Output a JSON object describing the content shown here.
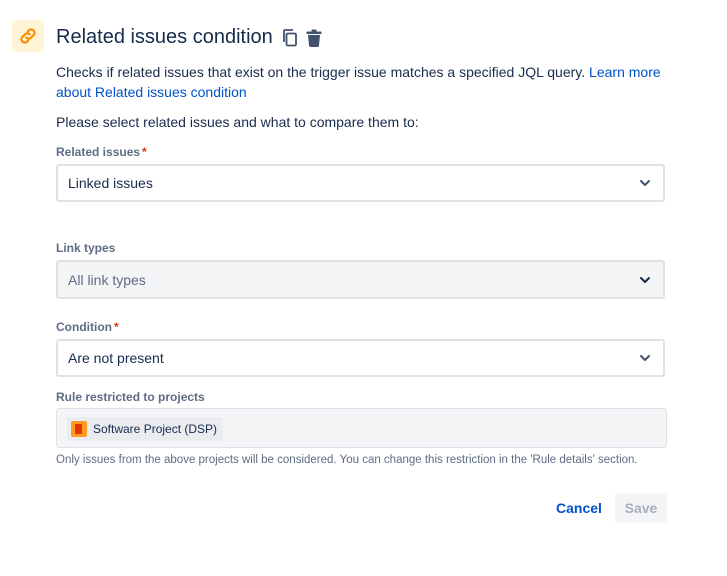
{
  "condition": {
    "title": "Related issues condition",
    "icon": "link-icon",
    "actions": [
      "copy-icon",
      "trash-icon"
    ]
  },
  "description": {
    "text": "Checks if related issues that exist on the trigger issue matches a specified JQL query.",
    "link_text": "Learn more about Related issues condition"
  },
  "prompt": "Please select related issues and what to compare them to:",
  "fields": {
    "related_issues": {
      "label": "Related issues",
      "required_mark": "*",
      "value": "Linked issues"
    },
    "link_types": {
      "label": "Link types",
      "placeholder": "All link types"
    },
    "condition": {
      "label": "Condition",
      "required_mark": "*",
      "value": "Are not present"
    },
    "projects": {
      "label": "Rule restricted to projects",
      "tag": "Software Project (DSP)",
      "help": "Only issues from the above projects will be considered. You can change this restriction in the 'Rule details' section."
    }
  },
  "buttons": {
    "cancel": "Cancel",
    "save": "Save"
  },
  "colors": {
    "accent": "#0052cc",
    "icon_bg": "#fff4d6",
    "link_icon": "#ff8b00",
    "required": "#de350b"
  }
}
